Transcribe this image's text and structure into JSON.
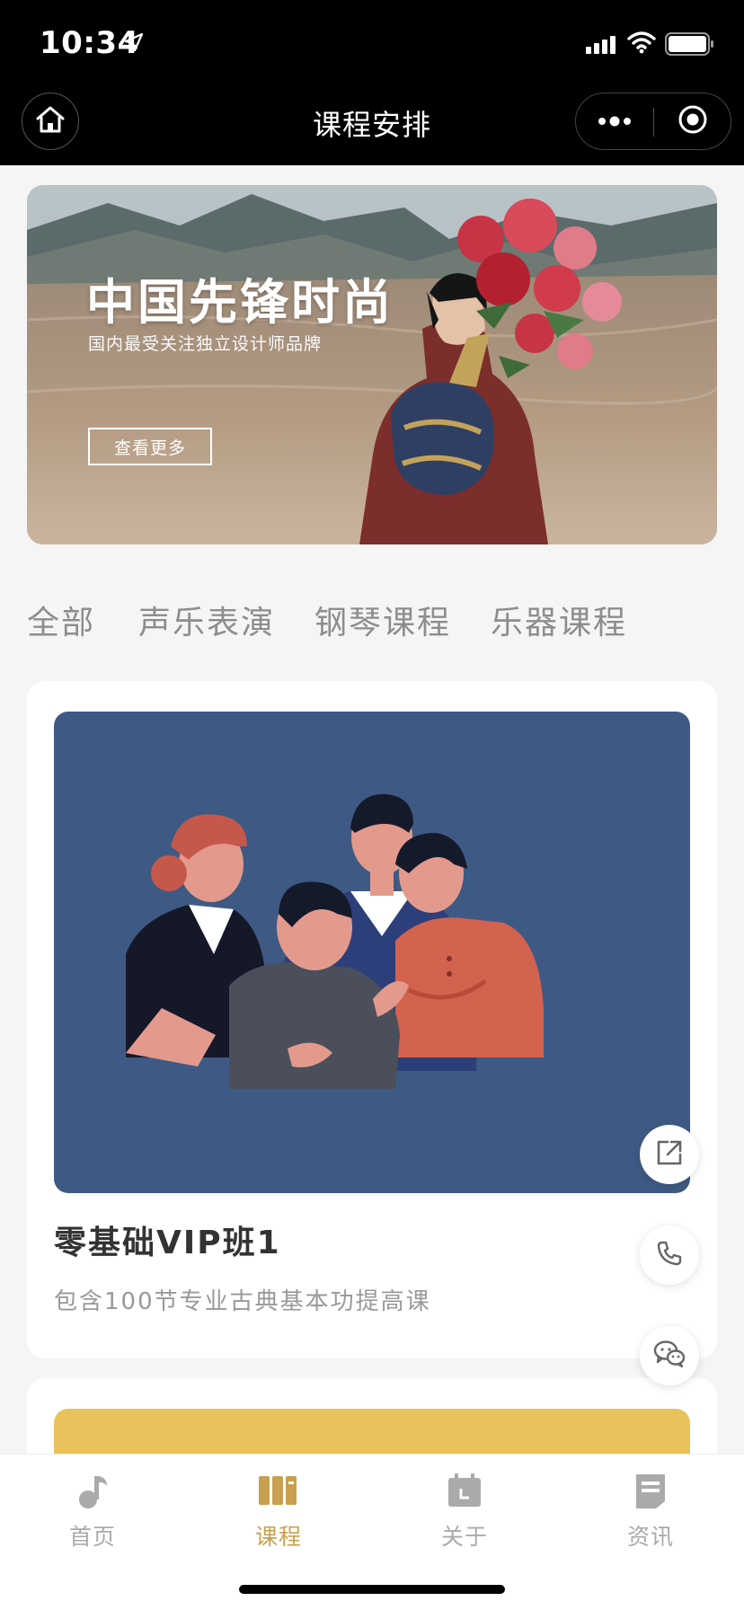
{
  "status_bar": {
    "time": "10:34"
  },
  "nav": {
    "title": "课程安排"
  },
  "banner": {
    "title": "中国先锋时尚",
    "subtitle": "国内最受关注独立设计师品牌",
    "button_label": "查看更多"
  },
  "tabs": [
    "全部",
    "声乐表演",
    "钢琴课程",
    "乐器课程"
  ],
  "courses": [
    {
      "title": "零基础VIP班1",
      "description": "包含100节专业古典基本功提高课",
      "image_color": "#3e5a84"
    },
    {
      "image_color": "#e8c25a"
    }
  ],
  "tab_bar": [
    {
      "label": "首页",
      "icon": "music-note-icon"
    },
    {
      "label": "课程",
      "icon": "books-icon",
      "active": true
    },
    {
      "label": "关于",
      "icon": "calendar-icon"
    },
    {
      "label": "资讯",
      "icon": "document-icon"
    }
  ],
  "colors": {
    "accent": "#c9a04f",
    "inactive": "#aaaaaa",
    "nav_bg": "#000000"
  }
}
